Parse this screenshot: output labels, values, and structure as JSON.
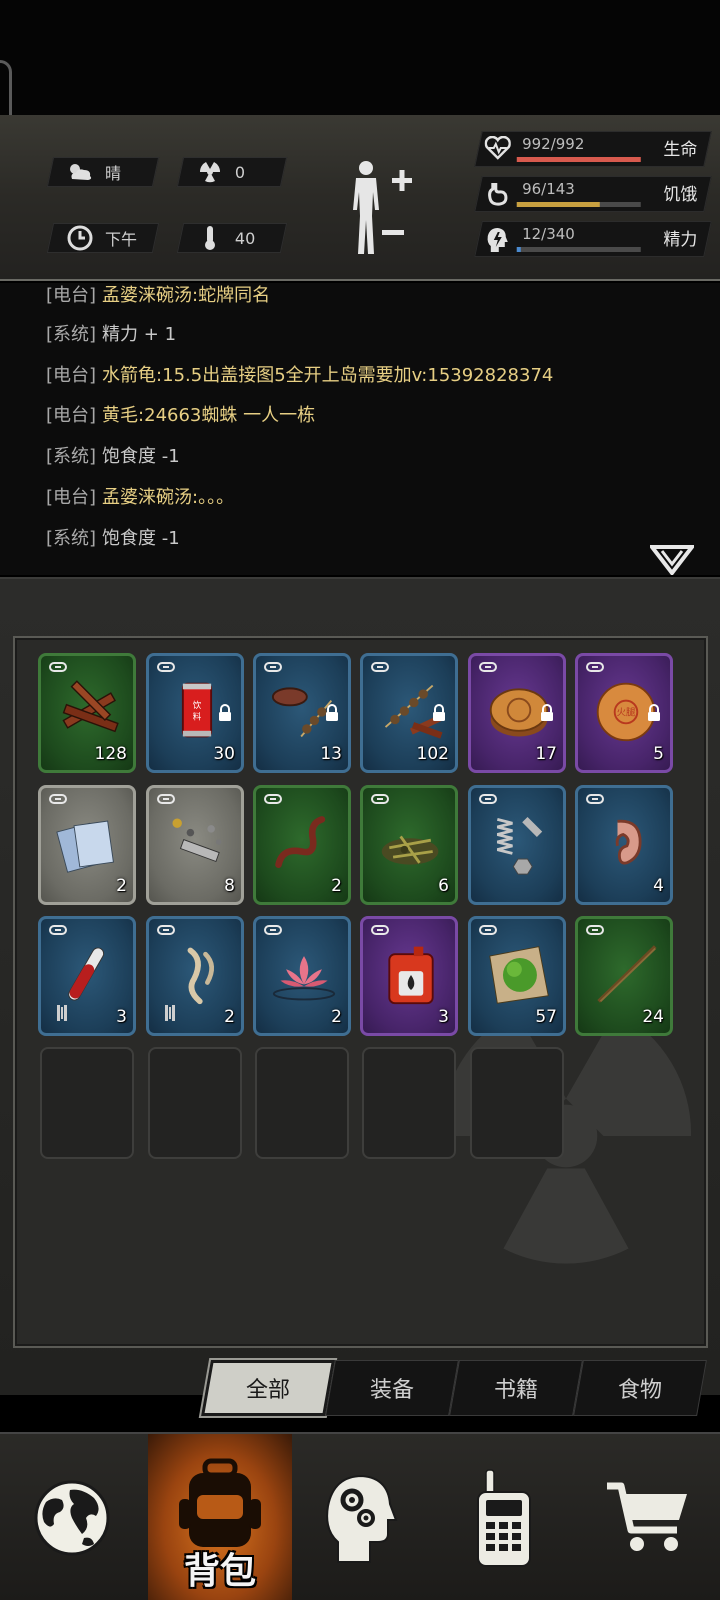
{
  "status": {
    "weather": "晴",
    "radiation": "0",
    "time_of_day": "下午",
    "temperature": "40"
  },
  "vitals": [
    {
      "name": "生命",
      "value": "992/992",
      "fraction": 1.0,
      "color": "#d85a4e",
      "icon": "heart-icon"
    },
    {
      "name": "饥饿",
      "value": "96/143",
      "fraction": 0.67,
      "color": "#c8a040",
      "icon": "stomach-icon"
    },
    {
      "name": "精力",
      "value": "12/340",
      "fraction": 0.035,
      "color": "#4a8ad0",
      "icon": "head-energy-icon"
    }
  ],
  "log": [
    {
      "tag": "[电台]",
      "text": "孟婆涞碗汤:蛇牌同名",
      "kind": "radio"
    },
    {
      "tag": "[系统]",
      "text": "精力 + 1",
      "kind": "sys"
    },
    {
      "tag": "[电台]",
      "text": "水箭龟:15.5出盖接图5全开上岛需要加v:15392828374",
      "kind": "radio"
    },
    {
      "tag": "[电台]",
      "text": "黄毛:24663蜘蛛 一人一栋",
      "kind": "radio"
    },
    {
      "tag": "[系统]",
      "text": "饱食度 -1",
      "kind": "sys"
    },
    {
      "tag": "[电台]",
      "text": "孟婆涞碗汤:。。。",
      "kind": "radio"
    },
    {
      "tag": "[系统]",
      "text": "饱食度 -1",
      "kind": "sys"
    }
  ],
  "inventory": [
    {
      "name": "wood-planks",
      "rarity": "green",
      "qty": "128",
      "locked": false
    },
    {
      "name": "soda-can",
      "rarity": "blue",
      "qty": "30",
      "locked": true,
      "label": "饮料"
    },
    {
      "name": "grilled-meat-skewer",
      "rarity": "blue",
      "qty": "13",
      "locked": true
    },
    {
      "name": "skewer-with-wood",
      "rarity": "blue",
      "qty": "102",
      "locked": true
    },
    {
      "name": "mooncake",
      "rarity": "purple",
      "qty": "17",
      "locked": true
    },
    {
      "name": "fire-mooncake",
      "rarity": "purple",
      "qty": "5",
      "locked": true,
      "label": "火腿"
    },
    {
      "name": "paper-sheets",
      "rarity": "gray",
      "qty": "2",
      "locked": false
    },
    {
      "name": "scrap-metal",
      "rarity": "gray",
      "qty": "8",
      "locked": false
    },
    {
      "name": "worm",
      "rarity": "green",
      "qty": "2",
      "locked": false
    },
    {
      "name": "herb-bundle",
      "rarity": "green",
      "qty": "6",
      "locked": false
    },
    {
      "name": "spring-and-bolt",
      "rarity": "blue",
      "qty": "",
      "locked": false
    },
    {
      "name": "ear-organ",
      "rarity": "blue",
      "qty": "4",
      "locked": false
    },
    {
      "name": "blood-vial",
      "rarity": "blue",
      "qty": "3",
      "locked": false
    },
    {
      "name": "bone-claws",
      "rarity": "blue",
      "qty": "2",
      "locked": false
    },
    {
      "name": "lotus-flower",
      "rarity": "blue",
      "qty": "2",
      "locked": false
    },
    {
      "name": "fuel-canister",
      "rarity": "purple",
      "qty": "3",
      "locked": false
    },
    {
      "name": "moss-cloth",
      "rarity": "blue",
      "qty": "57",
      "locked": false
    },
    {
      "name": "wooden-stick",
      "rarity": "green",
      "qty": "24",
      "locked": false
    }
  ],
  "empty_slots": 5,
  "tabs": [
    {
      "label": "全部",
      "active": true
    },
    {
      "label": "装备",
      "active": false
    },
    {
      "label": "书籍",
      "active": false
    },
    {
      "label": "食物",
      "active": false
    }
  ],
  "nav": {
    "backpack_label": "背包"
  }
}
